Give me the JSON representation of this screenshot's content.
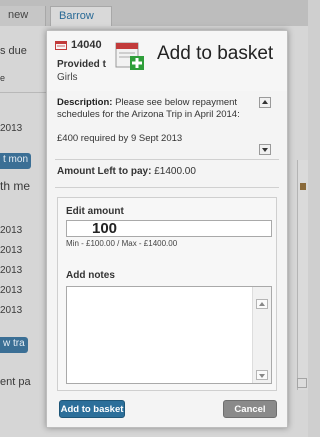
{
  "background": {
    "tabs": [
      "new",
      "Barrow"
    ],
    "left_fragments": [
      "s due",
      "e",
      "2013",
      "2013",
      "2013",
      "2013",
      "2013",
      "2013"
    ],
    "pills": [
      "t mon",
      "w tra"
    ],
    "th_me": "th me",
    "ent_pa": "ent pa"
  },
  "modal": {
    "reference": "14040",
    "provided_label": "Provided t",
    "provided_value": "Girls",
    "basket_title": "Add to basket",
    "description_label": "Description:",
    "description_text": "Please see below repayment schedules for the Arizona Trip in April 2014:",
    "description_cut": "£400 required by 9 Sept 2013",
    "amount_left_label": "Amount Left to pay:",
    "amount_left_value": "£1400.00",
    "edit_amount_label": "Edit amount",
    "edit_amount_value": "100",
    "min_max": "Min - £100.00 / Max - £1400.00",
    "add_notes_label": "Add notes",
    "notes_value": "",
    "add_button": "Add to basket",
    "cancel_button": "Cancel"
  },
  "colors": {
    "primary_button": "#2c6f9a",
    "cancel_button": "#8a8a8a",
    "basket_icon_green": "#2f9e3a",
    "doc_icon_red": "#c23b3b"
  },
  "icons": {
    "reference_icon": "document-icon",
    "basket_icon": "basket-add-icon"
  }
}
